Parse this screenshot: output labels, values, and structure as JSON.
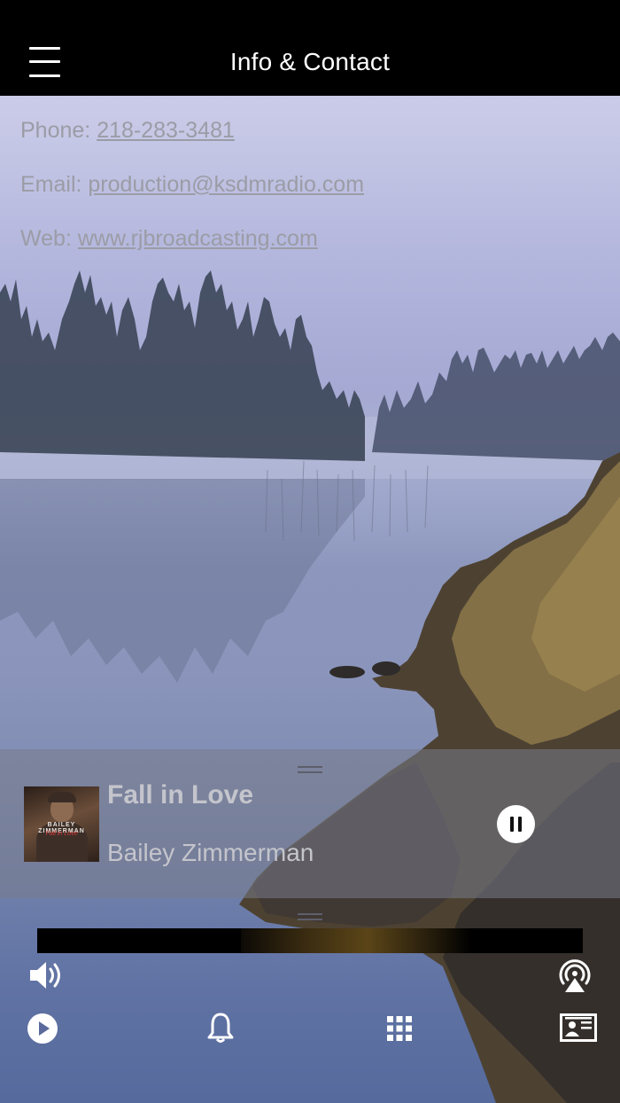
{
  "header": {
    "title": "Info & Contact"
  },
  "contact": {
    "phone_label": "Phone: ",
    "phone_value": "218-283-3481",
    "email_label": "Email: ",
    "email_value": "production@ksdmradio.com",
    "web_label": "Web: ",
    "web_value": "www.rjbroadcasting.com"
  },
  "now_playing": {
    "title": "Fall in Love",
    "artist": "Bailey Zimmerman",
    "album_art_text": "BAILEY ZIMMERMAN",
    "album_art_subtext": "Fall in Love",
    "state": "playing"
  },
  "controls": {
    "top_row": [
      {
        "icon": "volume-icon"
      },
      {
        "icon": "airplay-audio-icon"
      }
    ],
    "bottom_row": [
      {
        "icon": "play-circle-icon"
      },
      {
        "icon": "bell-icon"
      },
      {
        "icon": "grid-icon"
      },
      {
        "icon": "contact-card-icon"
      }
    ]
  },
  "colors": {
    "header_bg": "#000000",
    "header_text": "#ffffff",
    "contact_text": "#9b9ca6",
    "panel_text": "#c4c5cc"
  }
}
